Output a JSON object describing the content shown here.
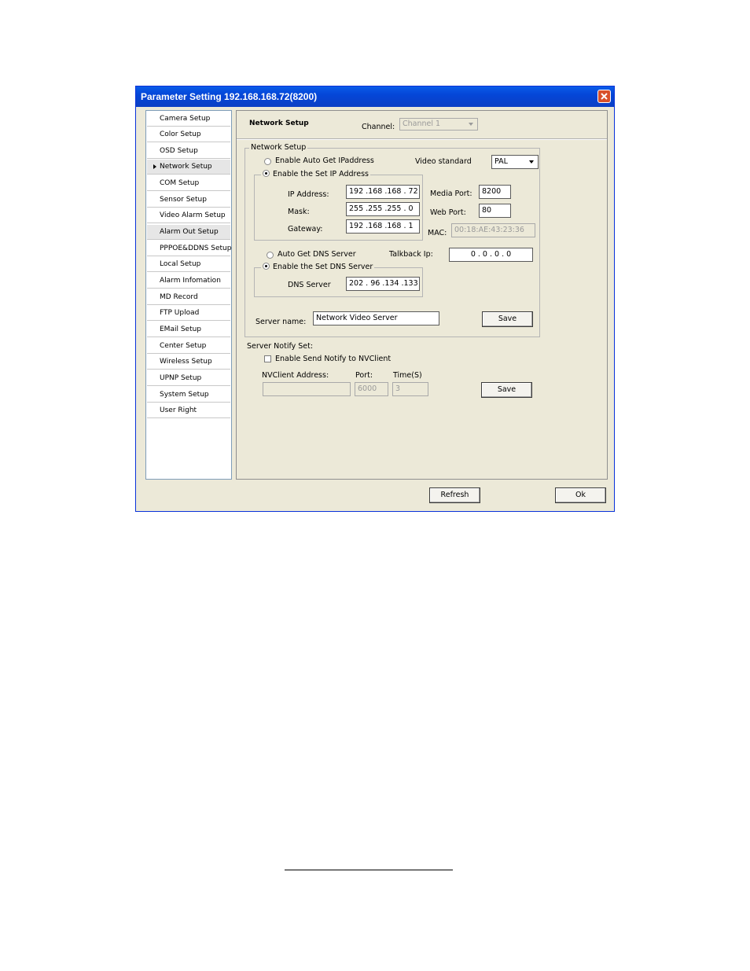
{
  "window": {
    "title": "Parameter Setting 192.168.168.72(8200)"
  },
  "sidebar": {
    "items": [
      {
        "label": "Camera Setup"
      },
      {
        "label": "Color Setup"
      },
      {
        "label": "OSD Setup"
      },
      {
        "label": "Network Setup",
        "active": true
      },
      {
        "label": "COM Setup"
      },
      {
        "label": "Sensor Setup"
      },
      {
        "label": "Video Alarm Setup"
      },
      {
        "label": "Alarm Out Setup"
      },
      {
        "label": "PPPOE&DDNS Setup"
      },
      {
        "label": "Local Setup"
      },
      {
        "label": "Alarm Infomation"
      },
      {
        "label": "MD Record"
      },
      {
        "label": "FTP Upload"
      },
      {
        "label": "EMail Setup"
      },
      {
        "label": "Center Setup"
      },
      {
        "label": "Wireless Setup"
      },
      {
        "label": "UPNP Setup"
      },
      {
        "label": "System Setup"
      },
      {
        "label": "User Right"
      }
    ]
  },
  "header": {
    "section_title": "Network Setup",
    "channel_label": "Channel:",
    "channel_value": "Channel 1"
  },
  "network": {
    "group_title": "Network Setup",
    "auto_ip_label": "Enable Auto Get IPaddress",
    "set_ip_label": "Enable the Set IP Address",
    "ip_label": "IP Address:",
    "ip_value": "192 .168 .168 . 72",
    "mask_label": "Mask:",
    "mask_value": "255 .255 .255 .  0",
    "gateway_label": "Gateway:",
    "gateway_value": "192 .168 .168 .  1",
    "video_standard_label": "Video standard",
    "video_standard_value": "PAL",
    "media_port_label": "Media Port:",
    "media_port_value": "8200",
    "web_port_label": "Web Port:",
    "web_port_value": "80",
    "mac_label": "MAC:",
    "mac_value": "00:18:AE:43:23:36",
    "auto_dns_label": "Auto Get DNS Server",
    "set_dns_label": "Enable the Set DNS Server",
    "dns_label": "DNS Server",
    "dns_value": "202 . 96 .134 .133",
    "talkback_label": "Talkback Ip:",
    "talkback_value": "0  .   0  .   0  .   0",
    "server_name_label": "Server name:",
    "server_name_value": "Network Video Server",
    "save_label": "Save"
  },
  "notify": {
    "group_label": "Server Notify Set:",
    "enable_label": "Enable Send Notify to NVClient",
    "address_label": "NVClient Address:",
    "address_value": "",
    "port_label": "Port:",
    "port_value": "6000",
    "time_label": "Time(S)",
    "time_value": "3",
    "save_label": "Save"
  },
  "footer": {
    "refresh_label": "Refresh",
    "ok_label": "Ok"
  },
  "colors": {
    "titlebar": "#0446d8",
    "window_bg": "#ece9d8",
    "close_button": "#d8502a"
  }
}
